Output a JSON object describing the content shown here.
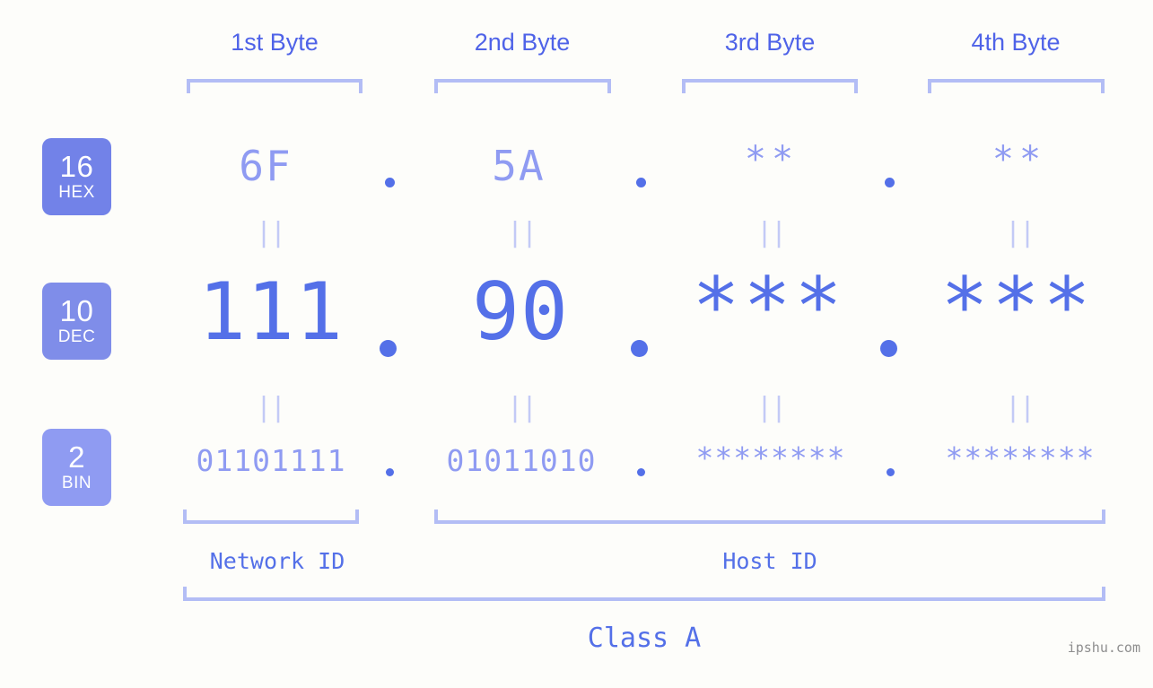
{
  "meta": {
    "background_color": "#fdfdfa",
    "accent_color": "#5470e8",
    "light_accent_color": "#8f9bf2",
    "bracket_color": "#b3bdf5",
    "watermark": "ipshu.com"
  },
  "byte_headers": [
    {
      "label": "1st Byte"
    },
    {
      "label": "2nd Byte"
    },
    {
      "label": "3rd Byte"
    },
    {
      "label": "4th Byte"
    }
  ],
  "radix_badges": [
    {
      "number": "16",
      "name": "HEX",
      "color": "#7282e8"
    },
    {
      "number": "10",
      "name": "DEC",
      "color": "#7f8de9"
    },
    {
      "number": "2",
      "name": "BIN",
      "color": "#8f9bf2"
    }
  ],
  "rows": {
    "hex": {
      "radix": "16",
      "radix_name": "HEX",
      "values": [
        "6F",
        "5A",
        "**",
        "**"
      ],
      "separator": "."
    },
    "dec": {
      "radix": "10",
      "radix_name": "DEC",
      "values": [
        "111",
        "90",
        "***",
        "***"
      ],
      "separator": "."
    },
    "bin": {
      "radix": "2",
      "radix_name": "BIN",
      "values": [
        "01101111",
        "01011010",
        "********",
        "********"
      ],
      "separator": "."
    }
  },
  "equivalence_mark": "||",
  "segments": {
    "network_id": "Network ID",
    "host_id": "Host ID",
    "class": "Class A"
  }
}
